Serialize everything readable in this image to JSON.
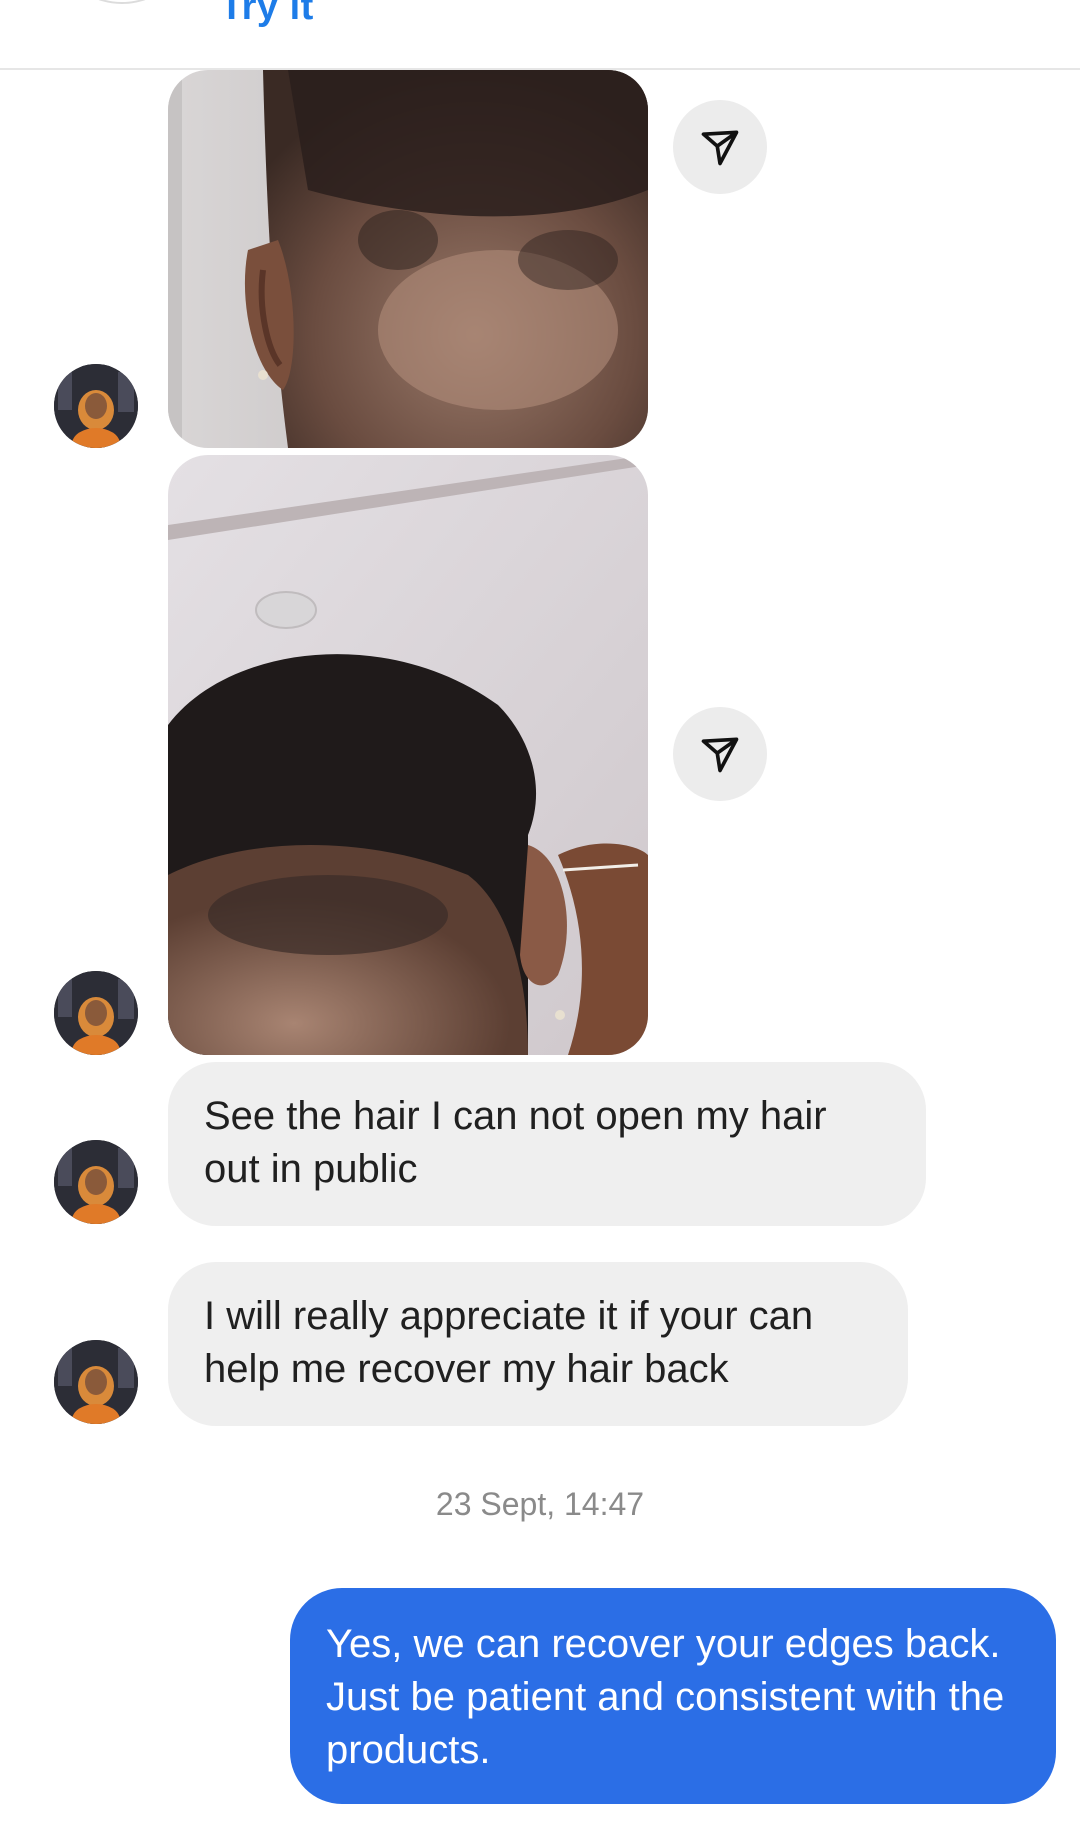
{
  "header": {
    "try_link": "Try it"
  },
  "messages": [
    {
      "type": "image",
      "sender": "them",
      "description_icon": "hair-photo-1"
    },
    {
      "type": "image",
      "sender": "them",
      "description_icon": "hair-photo-2"
    },
    {
      "type": "text",
      "sender": "them",
      "text": "See the hair  I can not open my hair out in public"
    },
    {
      "type": "text",
      "sender": "them",
      "text": "I will really appreciate it if your can help me recover my hair back"
    }
  ],
  "timestamp": "23 Sept, 14:47",
  "reply": {
    "text": "Yes, we can recover your edges back. Just be patient and consistent with the products."
  },
  "colors": {
    "accent": "#2b6ee6",
    "link": "#1d7ce8",
    "incoming_bubble": "#efefef",
    "share_button_bg": "#ececec"
  }
}
